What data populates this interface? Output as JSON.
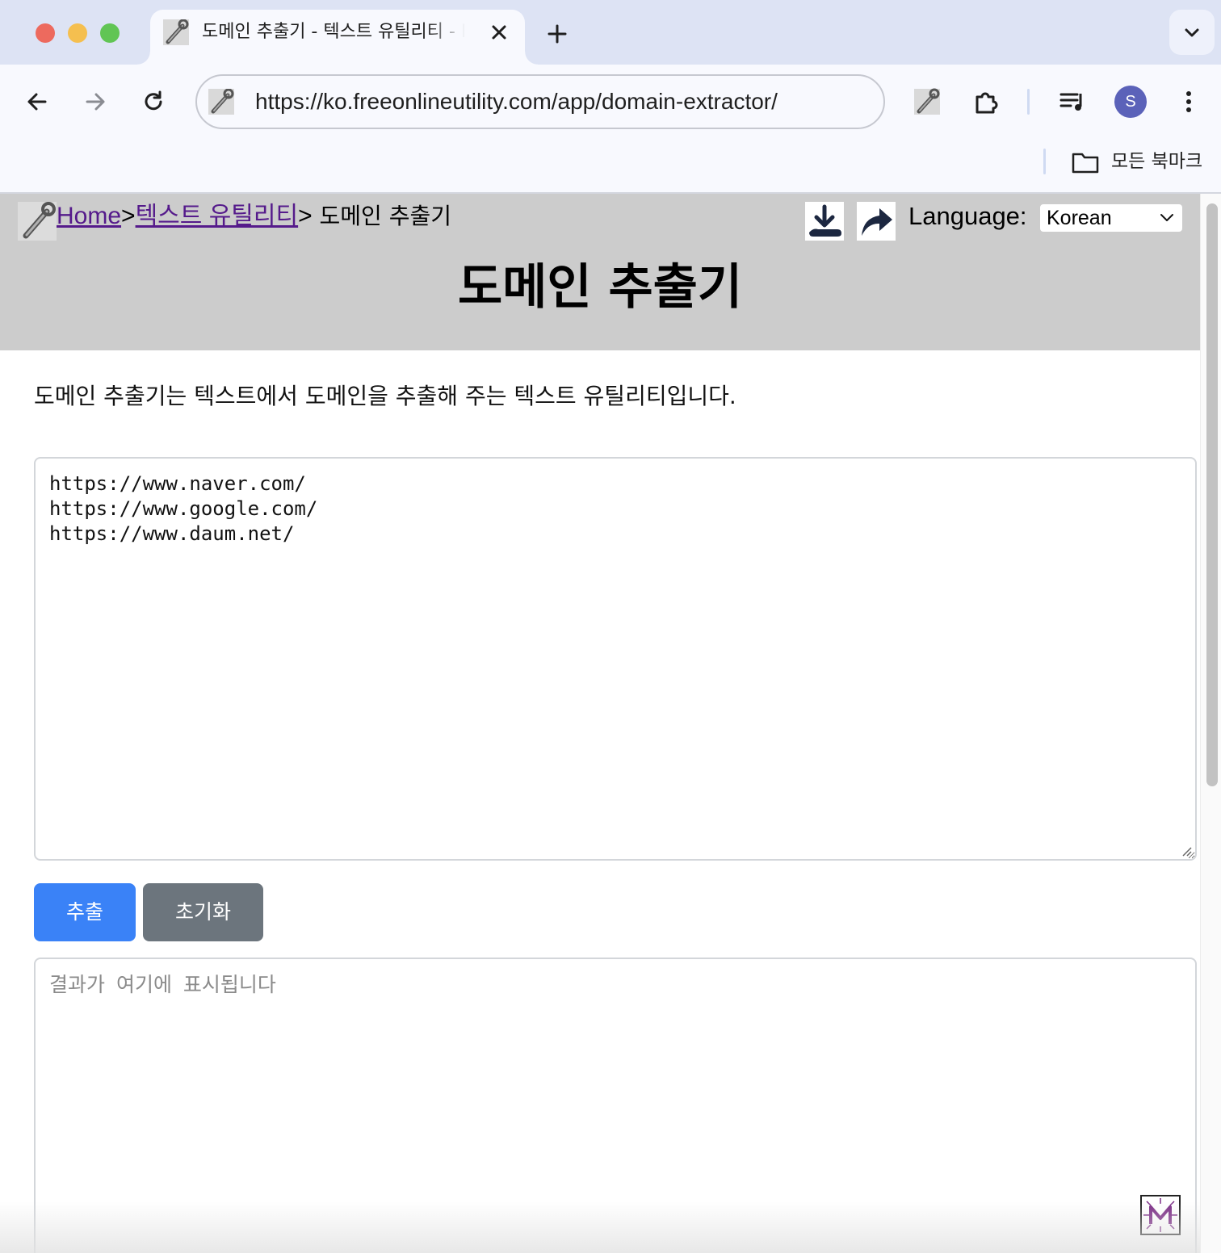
{
  "browser": {
    "tab_title": "도메인 추출기 - 텍스트 유틸리티 - Free Online Utility",
    "url": "https://ko.freeonlineutility.com/app/domain-extractor/",
    "profile_initial": "S",
    "bookmarks_label": "모든 북마크",
    "icons": [
      "back-icon",
      "forward-icon",
      "reload-icon",
      "extensions-icon",
      "media-controls-icon",
      "more-menu-icon",
      "folder-icon",
      "new-tab-icon",
      "close-icon",
      "tab-search-icon"
    ]
  },
  "header": {
    "breadcrumb": {
      "home": "Home",
      "sep1": ">",
      "category": "텍스트 유틸리티",
      "sep2": ">",
      "current": " 도메인 추출기"
    },
    "language_label": "Language:",
    "language_value": "Korean",
    "title": "도메인 추출기"
  },
  "description": "도메인 추출기는 텍스트에서 도메인을 추출해 주는 텍스트 유틸리티입니다.",
  "input": {
    "value": "https://www.naver.com/\nhttps://www.google.com/\nhttps://www.daum.net/"
  },
  "buttons": {
    "extract": "추출",
    "reset": "초기화"
  },
  "output": {
    "placeholder": "결과가 여기에 표시됩니다"
  },
  "colors": {
    "extract_button": "#3a82f7",
    "reset_button": "#6c757d",
    "header_background": "#cccccc",
    "link": "#551a8b",
    "avatar": "#5b62b9"
  }
}
